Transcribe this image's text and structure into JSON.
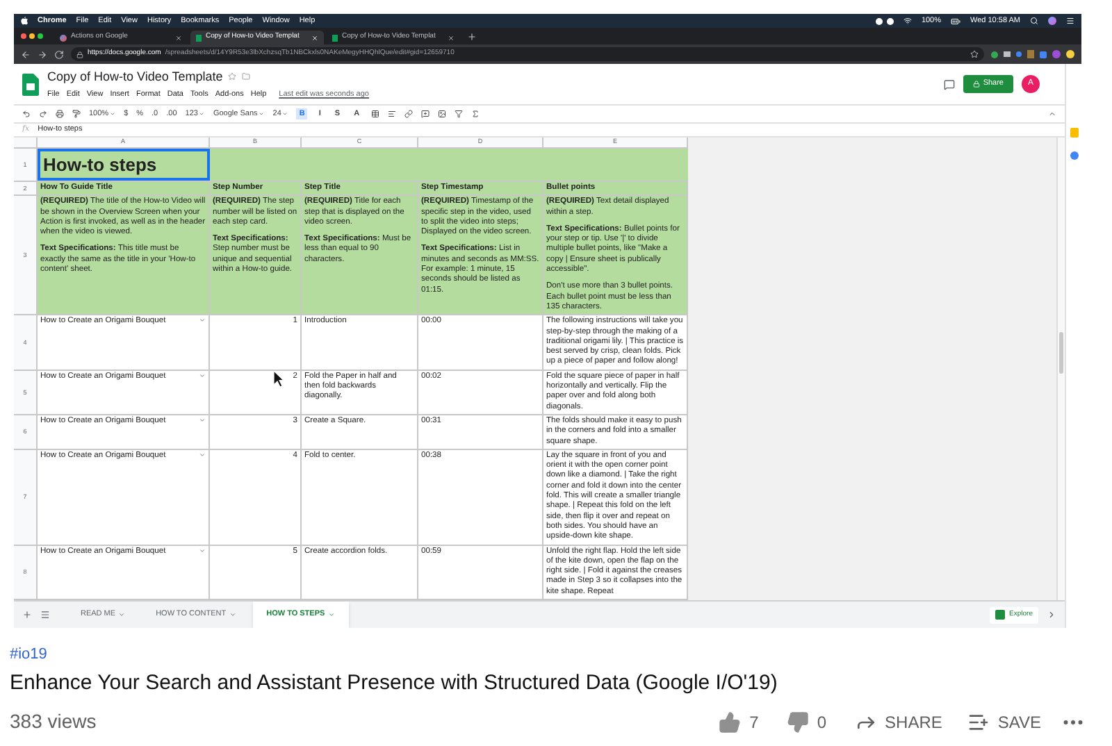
{
  "menu_bar": {
    "app": "Chrome",
    "items": [
      "File",
      "Edit",
      "View",
      "History",
      "Bookmarks",
      "People",
      "Window",
      "Help"
    ],
    "battery": "100%",
    "clock": "Wed 10:58 AM"
  },
  "browser_tabs": [
    {
      "title": "Actions on Google",
      "kind": "google",
      "selected": false
    },
    {
      "title": "Copy of How-to Video Templat",
      "kind": "sheets",
      "selected": true
    },
    {
      "title": "Copy of How-to Video Templat",
      "kind": "sheets",
      "selected": false
    }
  ],
  "address_bar": {
    "host": "https://docs.google.com",
    "path": "/spreadsheets/d/14Y9R53e3lbXchzsqTb1NBCkxls0NAKeMegyHHQhlQue/edit#gid=12659710"
  },
  "document": {
    "title": "Copy of How-to Video Template",
    "menus": [
      "File",
      "Edit",
      "View",
      "Insert",
      "Format",
      "Data",
      "Tools",
      "Add-ons",
      "Help"
    ],
    "last_edit": "Last edit was seconds ago",
    "share": "Share",
    "avatar": "A"
  },
  "toolbar": {
    "zoom": "100%",
    "currency": "$",
    "percent": "%",
    "decrease_decimals": ".0",
    "increase_decimals": ".00",
    "more_formats": "123",
    "font": "Google Sans",
    "font_size": "24",
    "format_buttons": [
      {
        "label": "B",
        "selected": true
      },
      {
        "label": "I",
        "selected": false
      },
      {
        "label": "S",
        "selected": false
      },
      {
        "label": "A",
        "selected": false
      }
    ]
  },
  "formula_bar": {
    "label": "fx",
    "value": "How-to steps"
  },
  "grid": {
    "columns": [
      "A",
      "B",
      "C",
      "D",
      "E"
    ],
    "rows": [
      {
        "number": "1",
        "kind": "title",
        "cells": [
          {
            "text": "How-to steps",
            "selected": true
          }
        ]
      },
      {
        "number": "2",
        "kind": "header",
        "cells": [
          {
            "text": "How To Guide Title"
          },
          {
            "text": "Step Number"
          },
          {
            "text": "Step Title"
          },
          {
            "text": "Step Timestamp"
          },
          {
            "text": "Bullet points"
          }
        ]
      },
      {
        "number": "3",
        "kind": "description",
        "cells": [
          {
            "paragraphs": [
              "**(REQUIRED)** The title of the How-to Video will be shown in the Overview Screen when your Action is first invoked, as well as in the header when the video is viewed.",
              "**Text Specifications:** This title must be exactly the same as the title in your 'How-to content' sheet."
            ]
          },
          {
            "paragraphs": [
              "**(REQUIRED)** The step number will be listed on each step card.",
              "**Text Specifications:** Step number must be unique and sequential within a How-to guide."
            ]
          },
          {
            "paragraphs": [
              "**(REQUIRED)** Title for each step that is displayed on the video screen.",
              "**Text Specifications:** Must be less than equal to 90 characters."
            ]
          },
          {
            "paragraphs": [
              "**(REQUIRED)** Timestamp of the specific step in the video, used to split the video into steps; Displayed on the video screen.",
              "**Text Specifications:** List in minutes and seconds as MM:SS. For example: 1 minute, 15 seconds should be listed as 01:15."
            ]
          },
          {
            "paragraphs": [
              "**(REQUIRED)** Text detail displayed within a step.",
              "**Text Specifications:** Bullet points for your step or tip. Use '|' to divide multiple bullet points, like \"Make a copy | Ensure sheet is publically accessible\".",
              "Don't use more than 3 bullet points. Each bullet point must be less than 135 characters."
            ]
          }
        ]
      },
      {
        "number": "4",
        "kind": "data",
        "cells": [
          {
            "text": "How to Create an Origami Bouquet"
          },
          {
            "text": "1"
          },
          {
            "text": "Introduction"
          },
          {
            "text": "00:00"
          },
          {
            "text": "The following instructions will take you step-by-step through the making of a traditional origami lily. | This practice is best served by crisp, clean folds. Pick up a piece of paper and follow along!"
          }
        ]
      },
      {
        "number": "5",
        "kind": "data",
        "cells": [
          {
            "text": "How to Create an Origami Bouquet"
          },
          {
            "text": "2"
          },
          {
            "text": "Fold the Paper in half and then fold backwards diagonally."
          },
          {
            "text": "00:02"
          },
          {
            "text": "Fold the square piece of paper in half horizontally and vertically. Flip the paper over and fold along both diagonals."
          }
        ]
      },
      {
        "number": "6",
        "kind": "data",
        "cells": [
          {
            "text": "How to Create an Origami Bouquet"
          },
          {
            "text": "3"
          },
          {
            "text": "Create a Square."
          },
          {
            "text": "00:31"
          },
          {
            "text": "The folds should make it easy to push in the corners and fold into a smaller square shape."
          }
        ]
      },
      {
        "number": "7",
        "kind": "data",
        "cells": [
          {
            "text": "How to Create an Origami Bouquet"
          },
          {
            "text": "4"
          },
          {
            "text": "Fold to center."
          },
          {
            "text": "00:38"
          },
          {
            "text": "Lay the square in front of you and orient it with the open corner point down like a diamond. | Take the right corner and fold it down into the center fold. This will create a smaller triangle shape. | Repeat this fold on the left side, then flip it over and repeat on both sides. You should have an upside-down kite shape."
          }
        ]
      },
      {
        "number": "8",
        "kind": "data",
        "cells": [
          {
            "text": "How to Create an Origami Bouquet"
          },
          {
            "text": "5"
          },
          {
            "text": "Create accordion folds."
          },
          {
            "text": "00:59"
          },
          {
            "text": "Unfold the right flap. Hold the left side of the kite down, open the flap on the right side. | Fold it against the creases made in Step 3 so it collapses into the kite shape. Repeat"
          }
        ]
      }
    ]
  },
  "sheet_tabs": [
    {
      "label": "READ ME",
      "selected": false
    },
    {
      "label": "HOW TO CONTENT",
      "selected": false
    },
    {
      "label": "HOW TO STEPS",
      "selected": true
    }
  ],
  "explore": "Explore",
  "video": {
    "hashtag": "#io19",
    "title": "Enhance Your Search and Assistant Presence with Structured Data (Google I/O'19)",
    "views": "383 views",
    "likes": "7",
    "dislikes": "0",
    "share": "SHARE",
    "save": "SAVE"
  }
}
